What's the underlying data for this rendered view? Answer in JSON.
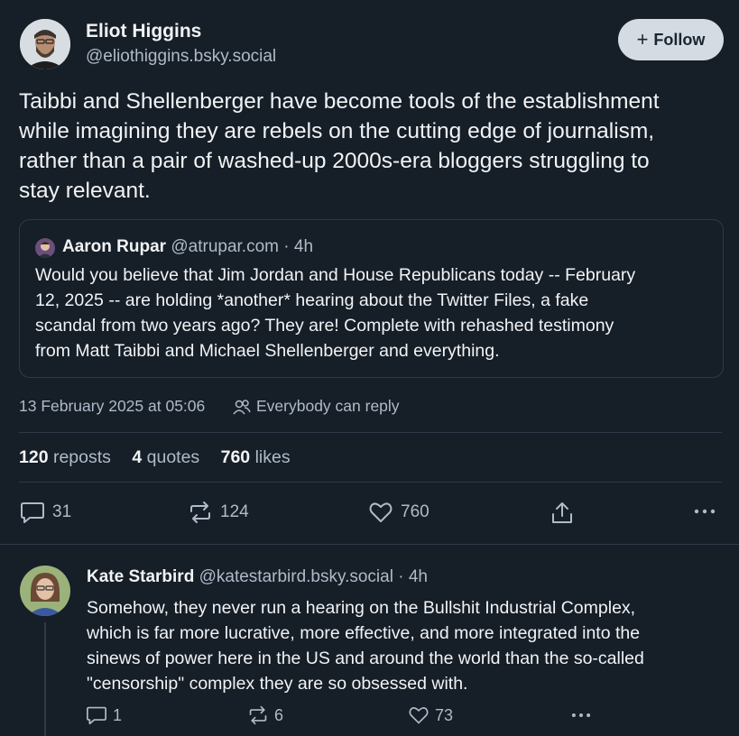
{
  "author": {
    "name": "Eliot Higgins",
    "handle": "@eliothiggins.bsky.social",
    "avatar_icon": "avatar-bearded-man"
  },
  "follow_button": {
    "label": "Follow",
    "icon": "plus-icon"
  },
  "post": {
    "lines": [
      "Taibbi and Shellenberger have become tools of the establishment",
      "while imagining they are rebels on the cutting edge of journalism,",
      "rather than a pair of washed-up 2000s-era bloggers struggling to",
      "stay relevant."
    ]
  },
  "quote": {
    "name": "Aaron Rupar",
    "handle": "@atrupar.com",
    "time": "· 4h",
    "lines": [
      "Would you believe that Jim Jordan and House Republicans today -- February",
      "12, 2025 -- are holding *another* hearing about the Twitter Files, a fake",
      "scandal from two years ago? They are! Complete with rehashed testimony",
      "from Matt Taibbi and Michael Shellenberger and everything."
    ]
  },
  "meta": {
    "timestamp": "13 February 2025 at 05:06",
    "reply_setting": "Everybody can reply"
  },
  "stats": {
    "reposts_count": "120",
    "reposts_label": "reposts",
    "quotes_count": "4",
    "quotes_label": "quotes",
    "likes_count": "760",
    "likes_label": "likes"
  },
  "actions": {
    "replies": "31",
    "reposts": "124",
    "likes": "760"
  },
  "reply": {
    "name": "Kate Starbird",
    "handle": "@katestarbird.bsky.social",
    "time": "· 4h",
    "lines": [
      "Somehow, they never run a hearing on the Bullshit Industrial Complex,",
      "which is far more lucrative, more effective, and more integrated into the",
      "sinews of power here in the US and around the world than the so-called",
      "\"censorship\" complex they are so obsessed with."
    ],
    "actions": {
      "replies": "1",
      "reposts": "6",
      "likes": "73"
    }
  },
  "colors": {
    "background": "#161e27",
    "text": "#f1f3f5",
    "muted": "#aebbc9",
    "border": "#2e3a49",
    "follow_bg": "#d4dbe2"
  }
}
